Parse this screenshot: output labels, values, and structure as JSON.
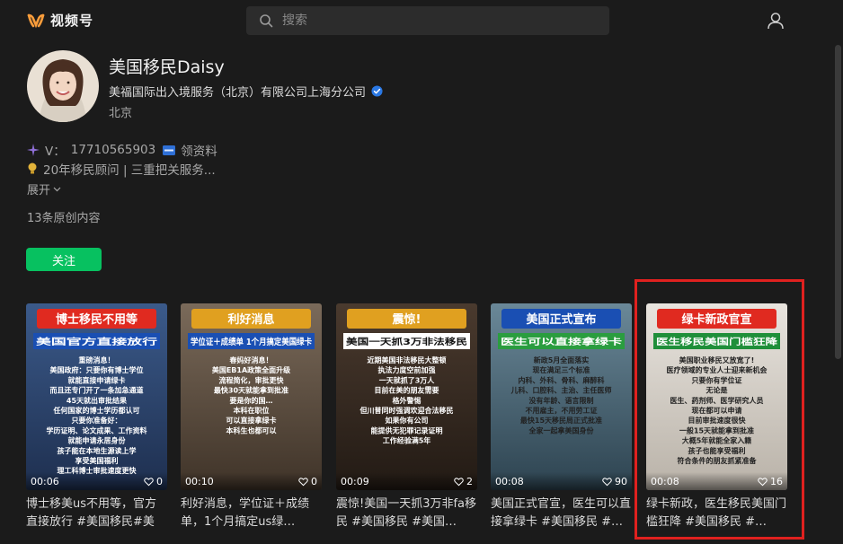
{
  "app": {
    "name": "视频号"
  },
  "search": {
    "placeholder": "搜索"
  },
  "profile": {
    "name": "美国移民Daisy",
    "company": "美福国际出入境服务（北京）有限公司上海分公司",
    "location": "北京",
    "contact_prefix": "V：",
    "phone": "17710565903",
    "contact_suffix": "领资料",
    "description": "20年移民顾问 | 三重把关服务...",
    "expand_label": "展开",
    "content_count": "13条原创内容",
    "follow_label": "关注"
  },
  "videos": [
    {
      "title": "博士移美us不用等，官方直接放行 #美国移民#美国…",
      "duration": "00:06",
      "likes": "0",
      "banner": "博士移民不用等",
      "subbanner": "美国官方直接放行",
      "lines": [
        "重磅消息！",
        "美国政府：只要你有博士学位",
        "就能直接申请绿卡",
        "而且还专门开了一条加急通道",
        "45天就出审批结果",
        "任何国家的博士学历都认可",
        "只要你准备好：",
        "学历证明、论文成果、工作资料",
        "就能申请永居身份",
        "孩子能在本地生源读上学",
        "享受美国福利",
        "理工科博士审批速度更快"
      ]
    },
    {
      "title": "利好消息，学位证＋成绩单，1个月搞定us绿…",
      "duration": "00:10",
      "likes": "0",
      "banner": "利好消息",
      "subbanner": "学位证＋成绩单 1个月搞定美国绿卡",
      "lines": [
        "春妈好消息！",
        "美国EB1A政策全面升级",
        "流程简化，审批更快",
        "最快30天就能拿到批准",
        "要是你的国…",
        "本科在职位",
        "可以直接拿绿卡",
        "本科生也都可以"
      ]
    },
    {
      "title": "震惊!美国一天抓3万非fa移民 #美国移民 #美国…",
      "duration": "00:09",
      "likes": "2",
      "banner": "震惊!",
      "subbanner": "美国一天抓3万非法移民",
      "lines": [
        "近期美国非法移民大整顿",
        "执法力度空前加强",
        "一天就抓了3万人",
        "目前在美的朋友需要",
        "格外警惕",
        "但川普同时强调欢迎合法移民",
        "如果你有公司",
        "能提供无犯罪记录证明",
        "工作经验满5年"
      ]
    },
    {
      "title": "美国正式官宣，医生可以直接拿绿卡 #美国移民 #…",
      "duration": "00:08",
      "likes": "90",
      "banner": "美国正式宣布",
      "subbanner": "医生可以直接拿绿卡",
      "lines": [
        "新政5月全面落实",
        "现在满足三个标准",
        "内科、外科、骨科、麻醉科",
        "儿科、口腔科、主治、主任医师",
        "没有年龄、语言限制",
        "不用雇主，不用劳工证",
        "最快15天移民局正式批准",
        "全家一起拿美国身份"
      ]
    },
    {
      "title": "绿卡新政，医生移民美国门槛狂降 #美国移民 #…",
      "duration": "00:08",
      "likes": "16",
      "banner": "绿卡新政官宣",
      "subbanner": "医生移民美国门槛狂降",
      "lines": [
        "美国职业移民又放宽了!",
        "医疗领域的专业人士迎来新机会",
        "只要你有学位证",
        "无论是",
        "医生、药剂师、医学研究人员",
        "现在都可以申请",
        "目前审批速度很快",
        "一般15天就能拿到批准",
        "大概5年就能全家入籍",
        "孩子也能享受福利",
        "符合条件的朋友抓紧准备"
      ]
    }
  ],
  "colors": {
    "accent": "#07c160",
    "highlight": "#e0211f",
    "banner_red": "#e02a20",
    "banner_blue": "#1a4fb3"
  }
}
